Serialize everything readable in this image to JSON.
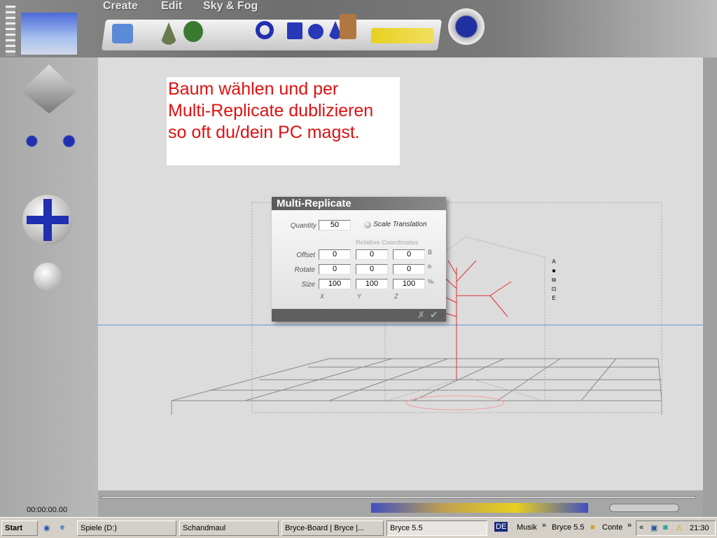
{
  "menu": {
    "create": "Create",
    "edit": "Edit",
    "skyfog": "Sky & Fog"
  },
  "note": {
    "lines": [
      "Baum wählen und per",
      "Multi-Replicate dublizieren",
      "so oft du/dein PC magst."
    ]
  },
  "dialog": {
    "title": "Multi-Replicate",
    "quantity_label": "Quantity",
    "quantity": "50",
    "scale_translation": "Scale Translation",
    "relative": "Relative Coordinates",
    "rows": [
      {
        "label": "Offset",
        "x": "0",
        "y": "0",
        "z": "0",
        "unit": "B"
      },
      {
        "label": "Rotate",
        "x": "0",
        "y": "0",
        "z": "0",
        "unit": "o"
      },
      {
        "label": "Size",
        "x": "100",
        "y": "100",
        "z": "100",
        "unit": "%"
      }
    ],
    "axes": [
      "X",
      "Y",
      "Z"
    ],
    "cancel": "✗",
    "ok": "✔"
  },
  "timecode": "00:00:00.00",
  "taskbar": {
    "start": "Start",
    "items": [
      "Spiele (D:)",
      "Schandmaul",
      "Bryce-Board | Bryce |...",
      "Bryce 5.5"
    ],
    "lang": "DE",
    "quick": [
      "Musik",
      "»",
      "Bryce 5.5",
      "Conte",
      "»"
    ],
    "tray_arrow": "«",
    "clock": "21:30"
  },
  "colors": {
    "note_text": "#e01010",
    "tree": "#e03030"
  }
}
